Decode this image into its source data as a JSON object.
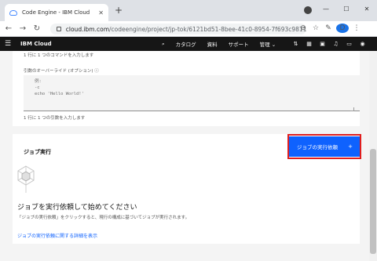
{
  "browser": {
    "tab_title": "Code Engine - IBM Cloud",
    "url_host": "cloud.ibm.com",
    "url_path": "/codeengine/project/jp-tok/6121bd51-8bee-41c0-8954-7f693c981131/...",
    "profile_initial": "D"
  },
  "ibm_header": {
    "brand": "IBM Cloud",
    "nav": [
      "カタログ",
      "資料",
      "サポート",
      "管理 ⌄"
    ]
  },
  "command_section": {
    "hint_top": "1 行に 1 つのコマンドを入力します",
    "args_label": "引数のオーバーライド (オプション) ⓘ",
    "args_placeholder": "例:\n-c\necho 'Hello World!'",
    "args_hint": "1 行に 1 つの引数を入力します"
  },
  "job_run": {
    "section_title": "ジョブ実行",
    "run_button_label": "ジョブの実行依頼",
    "run_button_icon": "+",
    "empty_title": "ジョブを実行依頼して始めてください",
    "empty_description": "「ジョブの実行依頼」をクリックすると、現行の構成に基づいてジョブが実行されます。",
    "learn_more_link": "ジョブの実行依頼に関する詳細を表示"
  },
  "colors": {
    "primary": "#0f62fe",
    "highlight": "#e01e1e",
    "header_bg": "#161616"
  }
}
